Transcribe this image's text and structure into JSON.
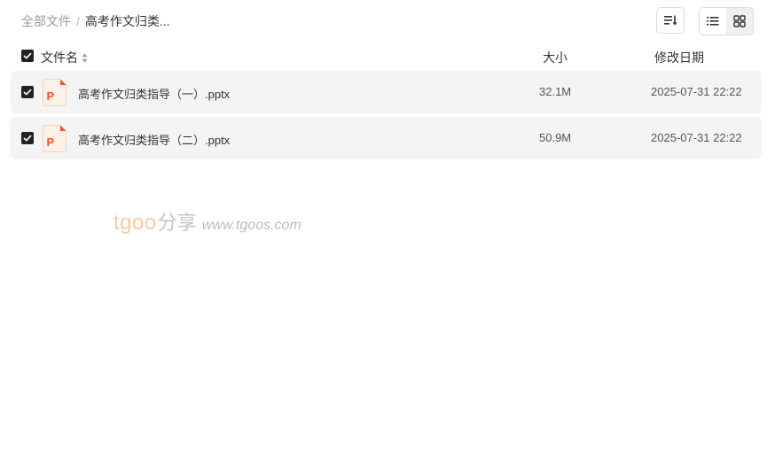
{
  "breadcrumb": {
    "root": "全部文件",
    "separator": "/",
    "current": "高考作文归类..."
  },
  "toolbar": {
    "sort_icon": "sort-icon",
    "list_view_icon": "list-view-icon",
    "grid_view_icon": "grid-view-icon"
  },
  "columns": {
    "name": "文件名",
    "size": "大小",
    "modified": "修改日期"
  },
  "files": [
    {
      "name": "高考作文归类指导（一）.pptx",
      "size": "32.1M",
      "modified": "2025-07-31 22:22",
      "icon": "pptx-file-icon",
      "checked": true
    },
    {
      "name": "高考作文归类指导（二）.pptx",
      "size": "50.9M",
      "modified": "2025-07-31 22:22",
      "icon": "pptx-file-icon",
      "checked": true
    }
  ],
  "watermark": {
    "brand": "tgoo",
    "cn": "分享",
    "url": "www.tgoos.com"
  },
  "colors": {
    "row_bg": "#f4f4f4",
    "checkbox": "#222222",
    "pptx_orange": "#e8592b"
  }
}
